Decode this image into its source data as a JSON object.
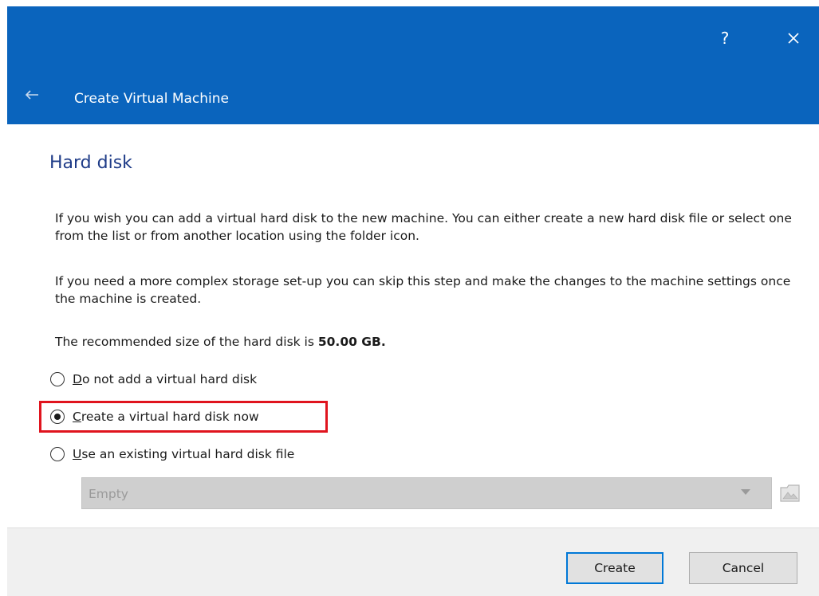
{
  "titlebar": {
    "help_label": "?",
    "title": "Create Virtual Machine"
  },
  "icons": {
    "help": "help-icon",
    "close": "close-icon",
    "back": "back-arrow-icon",
    "folder": "folder-icon"
  },
  "colors": {
    "titlebar_bg": "#0a64bd",
    "accent": "#0078d7",
    "section_title": "#1f3c88",
    "highlight": "#e0141e"
  },
  "page": {
    "section_title": "Hard disk",
    "paragraph_1": "If you wish you can add a virtual hard disk to the new machine. You can either create a new hard disk file or select one from the list or from another location using the folder icon.",
    "paragraph_2": "If you need a more complex storage set-up you can skip this step and make the changes to the machine settings once the machine is created.",
    "recommended_prefix": "The recommended size of the hard disk is ",
    "recommended_size": "50.00 GB",
    "recommended_suffix": "."
  },
  "options": [
    {
      "accel": "D",
      "rest": "o not add a virtual hard disk",
      "selected": false
    },
    {
      "accel": "C",
      "rest": "reate a virtual hard disk now",
      "selected": true
    },
    {
      "accel": "U",
      "rest": "se an existing virtual hard disk file",
      "selected": false
    }
  ],
  "disk_select": {
    "value": "Empty",
    "enabled": false
  },
  "buttons": {
    "create": "Create",
    "cancel": "Cancel"
  }
}
